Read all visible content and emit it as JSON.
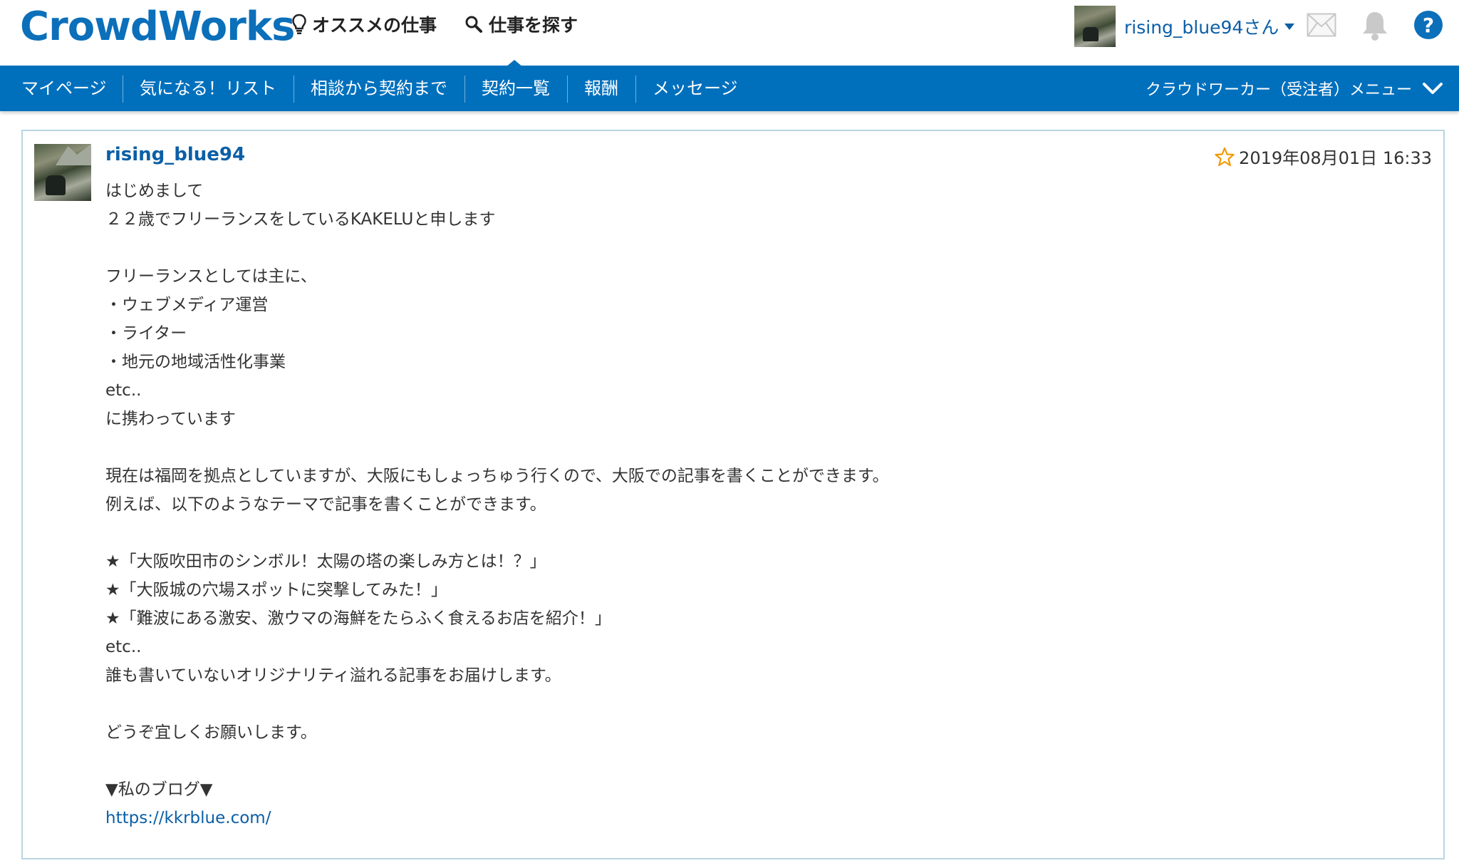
{
  "header": {
    "logo": "CrowdWorks",
    "recommended_label": "オススメの仕事",
    "search_label": "仕事を探す",
    "user_name": "rising_blue94さん"
  },
  "nav": {
    "items": [
      {
        "label": "マイページ"
      },
      {
        "label": "気になる！リスト"
      },
      {
        "label": "相談から契約まで"
      },
      {
        "label": "契約一覧"
      },
      {
        "label": "報酬"
      },
      {
        "label": "メッセージ"
      }
    ],
    "worker_menu_label": "クラウドワーカー（受注者）メニュー"
  },
  "message": {
    "sender": "rising_blue94",
    "timestamp": "2019年08月01日 16:33",
    "lines": [
      "はじめまして",
      "２２歳でフリーランスをしているKAKELUと申します",
      "",
      "フリーランスとしては主に、",
      "・ウェブメディア運営",
      "・ライター",
      "・地元の地域活性化事業",
      "etc..",
      "に携わっています",
      "",
      "現在は福岡を拠点としていますが、大阪にもしょっちゅう行くので、大阪での記事を書くことができます。",
      "例えば、以下のようなテーマで記事を書くことができます。",
      "",
      "★「大阪吹田市のシンボル！太陽の塔の楽しみ方とは！？」",
      "★「大阪城の穴場スポットに突撃してみた！」",
      "★「難波にある激安、激ウマの海鮮をたらふく食えるお店を紹介！」",
      "etc..",
      "誰も書いていないオリジナリティ溢れる記事をお届けします。",
      "",
      "どうぞ宜しくお願いします。",
      "",
      "▼私のブログ▼"
    ],
    "blog_link": "https://kkrblue.com/"
  },
  "colors": {
    "brand": "#0b6fba",
    "nav_bg": "#0070bd",
    "link": "#0b5fa6",
    "card_border": "#b9d5e1",
    "star": "#f39800"
  },
  "icons": [
    "lightbulb-icon",
    "search-icon",
    "mail-icon",
    "bell-icon",
    "help-icon",
    "chevron-down-icon",
    "star-icon"
  ]
}
